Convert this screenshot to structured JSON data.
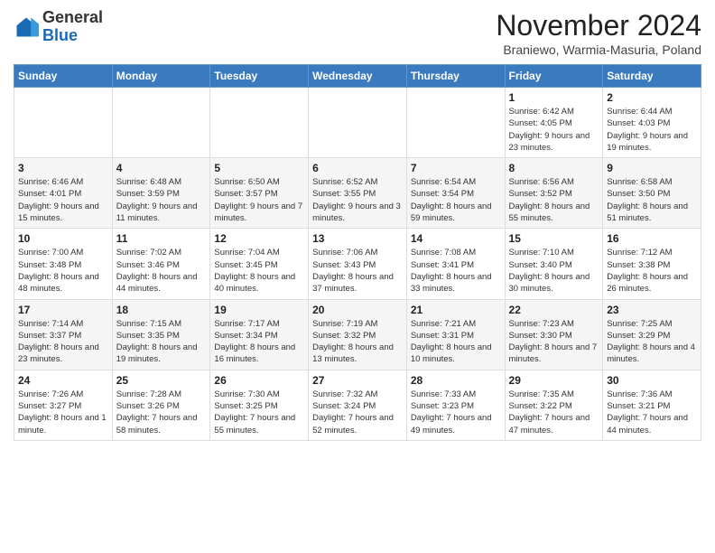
{
  "header": {
    "logo_general": "General",
    "logo_blue": "Blue",
    "month_year": "November 2024",
    "location": "Braniewo, Warmia-Masuria, Poland"
  },
  "columns": [
    "Sunday",
    "Monday",
    "Tuesday",
    "Wednesday",
    "Thursday",
    "Friday",
    "Saturday"
  ],
  "weeks": [
    [
      {
        "day": "",
        "info": ""
      },
      {
        "day": "",
        "info": ""
      },
      {
        "day": "",
        "info": ""
      },
      {
        "day": "",
        "info": ""
      },
      {
        "day": "",
        "info": ""
      },
      {
        "day": "1",
        "info": "Sunrise: 6:42 AM\nSunset: 4:05 PM\nDaylight: 9 hours and 23 minutes."
      },
      {
        "day": "2",
        "info": "Sunrise: 6:44 AM\nSunset: 4:03 PM\nDaylight: 9 hours and 19 minutes."
      }
    ],
    [
      {
        "day": "3",
        "info": "Sunrise: 6:46 AM\nSunset: 4:01 PM\nDaylight: 9 hours and 15 minutes."
      },
      {
        "day": "4",
        "info": "Sunrise: 6:48 AM\nSunset: 3:59 PM\nDaylight: 9 hours and 11 minutes."
      },
      {
        "day": "5",
        "info": "Sunrise: 6:50 AM\nSunset: 3:57 PM\nDaylight: 9 hours and 7 minutes."
      },
      {
        "day": "6",
        "info": "Sunrise: 6:52 AM\nSunset: 3:55 PM\nDaylight: 9 hours and 3 minutes."
      },
      {
        "day": "7",
        "info": "Sunrise: 6:54 AM\nSunset: 3:54 PM\nDaylight: 8 hours and 59 minutes."
      },
      {
        "day": "8",
        "info": "Sunrise: 6:56 AM\nSunset: 3:52 PM\nDaylight: 8 hours and 55 minutes."
      },
      {
        "day": "9",
        "info": "Sunrise: 6:58 AM\nSunset: 3:50 PM\nDaylight: 8 hours and 51 minutes."
      }
    ],
    [
      {
        "day": "10",
        "info": "Sunrise: 7:00 AM\nSunset: 3:48 PM\nDaylight: 8 hours and 48 minutes."
      },
      {
        "day": "11",
        "info": "Sunrise: 7:02 AM\nSunset: 3:46 PM\nDaylight: 8 hours and 44 minutes."
      },
      {
        "day": "12",
        "info": "Sunrise: 7:04 AM\nSunset: 3:45 PM\nDaylight: 8 hours and 40 minutes."
      },
      {
        "day": "13",
        "info": "Sunrise: 7:06 AM\nSunset: 3:43 PM\nDaylight: 8 hours and 37 minutes."
      },
      {
        "day": "14",
        "info": "Sunrise: 7:08 AM\nSunset: 3:41 PM\nDaylight: 8 hours and 33 minutes."
      },
      {
        "day": "15",
        "info": "Sunrise: 7:10 AM\nSunset: 3:40 PM\nDaylight: 8 hours and 30 minutes."
      },
      {
        "day": "16",
        "info": "Sunrise: 7:12 AM\nSunset: 3:38 PM\nDaylight: 8 hours and 26 minutes."
      }
    ],
    [
      {
        "day": "17",
        "info": "Sunrise: 7:14 AM\nSunset: 3:37 PM\nDaylight: 8 hours and 23 minutes."
      },
      {
        "day": "18",
        "info": "Sunrise: 7:15 AM\nSunset: 3:35 PM\nDaylight: 8 hours and 19 minutes."
      },
      {
        "day": "19",
        "info": "Sunrise: 7:17 AM\nSunset: 3:34 PM\nDaylight: 8 hours and 16 minutes."
      },
      {
        "day": "20",
        "info": "Sunrise: 7:19 AM\nSunset: 3:32 PM\nDaylight: 8 hours and 13 minutes."
      },
      {
        "day": "21",
        "info": "Sunrise: 7:21 AM\nSunset: 3:31 PM\nDaylight: 8 hours and 10 minutes."
      },
      {
        "day": "22",
        "info": "Sunrise: 7:23 AM\nSunset: 3:30 PM\nDaylight: 8 hours and 7 minutes."
      },
      {
        "day": "23",
        "info": "Sunrise: 7:25 AM\nSunset: 3:29 PM\nDaylight: 8 hours and 4 minutes."
      }
    ],
    [
      {
        "day": "24",
        "info": "Sunrise: 7:26 AM\nSunset: 3:27 PM\nDaylight: 8 hours and 1 minute."
      },
      {
        "day": "25",
        "info": "Sunrise: 7:28 AM\nSunset: 3:26 PM\nDaylight: 7 hours and 58 minutes."
      },
      {
        "day": "26",
        "info": "Sunrise: 7:30 AM\nSunset: 3:25 PM\nDaylight: 7 hours and 55 minutes."
      },
      {
        "day": "27",
        "info": "Sunrise: 7:32 AM\nSunset: 3:24 PM\nDaylight: 7 hours and 52 minutes."
      },
      {
        "day": "28",
        "info": "Sunrise: 7:33 AM\nSunset: 3:23 PM\nDaylight: 7 hours and 49 minutes."
      },
      {
        "day": "29",
        "info": "Sunrise: 7:35 AM\nSunset: 3:22 PM\nDaylight: 7 hours and 47 minutes."
      },
      {
        "day": "30",
        "info": "Sunrise: 7:36 AM\nSunset: 3:21 PM\nDaylight: 7 hours and 44 minutes."
      }
    ]
  ]
}
